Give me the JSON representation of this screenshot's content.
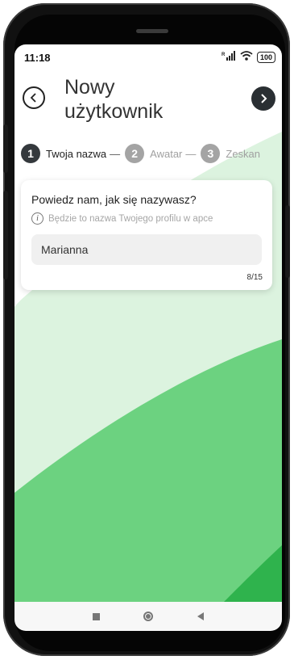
{
  "status_bar": {
    "time": "11:18",
    "signal_label": "R",
    "battery": "100"
  },
  "header": {
    "title_line1": "Nowy",
    "title_line2": "użytkownik",
    "back_icon": "chevron-left-icon",
    "next_icon": "chevron-right-icon"
  },
  "steps": [
    {
      "number": "1",
      "label": "Twoja nazwa",
      "state": "active"
    },
    {
      "number": "2",
      "label": "Awatar",
      "state": "inactive"
    },
    {
      "number": "3",
      "label": "Zeskan",
      "state": "inactive"
    }
  ],
  "form": {
    "question": "Powiedz nam, jak się nazywasz?",
    "hint": "Będzie to nazwa Twojego profilu w apce",
    "name_value": "Marianna",
    "counter": "8/15"
  },
  "colors": {
    "accent_dark": "#2a2f33",
    "green_light": "#dcf3df",
    "green_mid": "#6cd280",
    "green_deep": "#2fb34d"
  }
}
